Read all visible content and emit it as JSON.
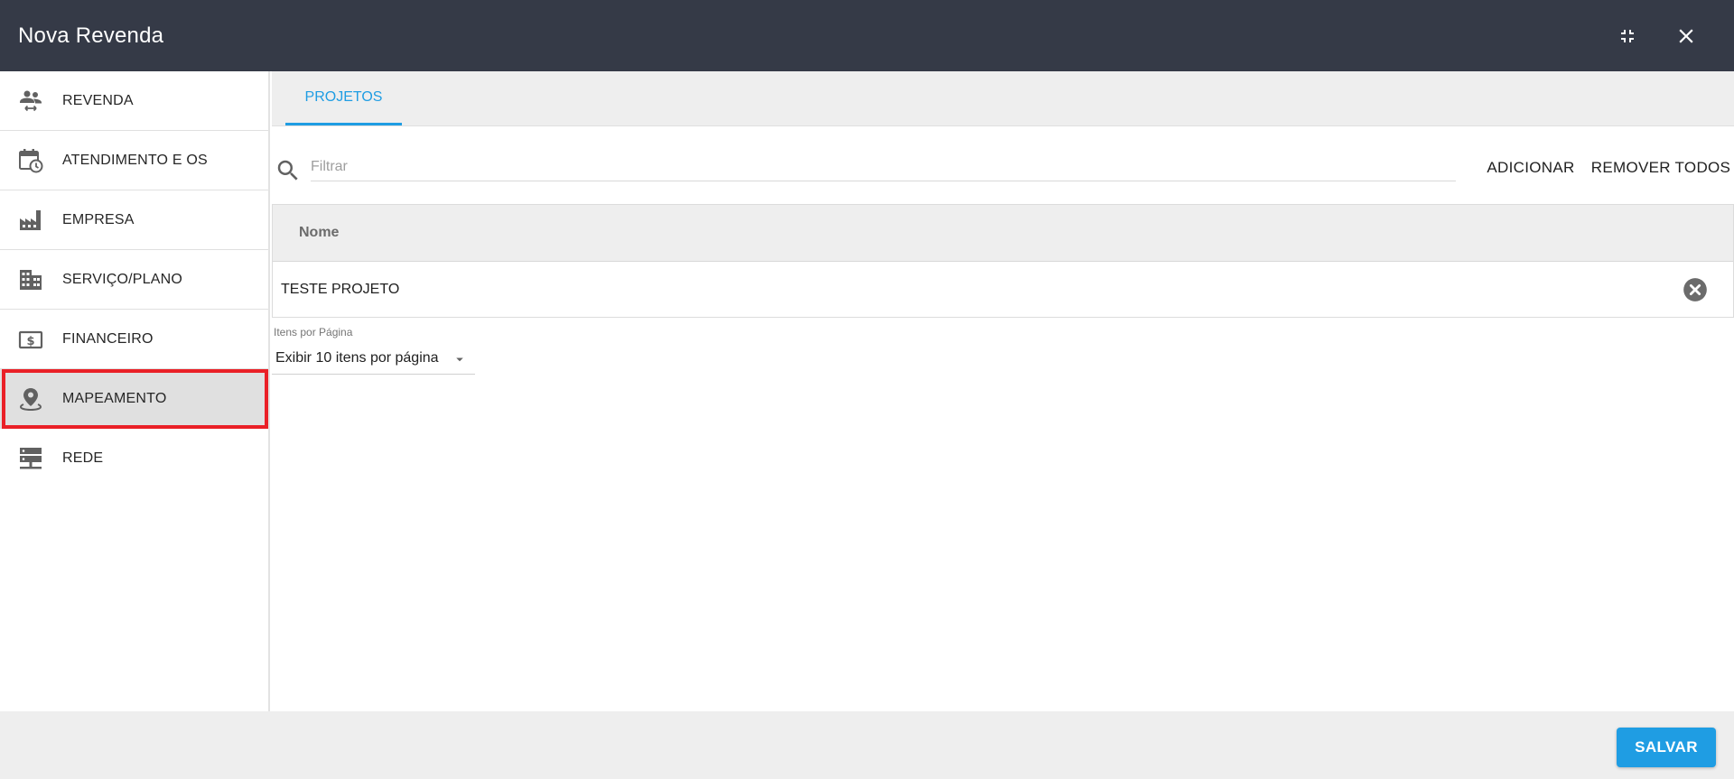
{
  "window": {
    "title": "Nova Revenda",
    "minimize_icon": "fullscreen-exit-icon",
    "close_icon": "close-icon"
  },
  "sidebar": {
    "items": [
      {
        "label": "REVENDA",
        "icon": "people-transfer-icon",
        "selected": false
      },
      {
        "label": "ATENDIMENTO E OS",
        "icon": "calendar-clock-icon",
        "selected": false
      },
      {
        "label": "EMPRESA",
        "icon": "factory-icon",
        "selected": false
      },
      {
        "label": "SERVIÇO/PLANO",
        "icon": "building-icon",
        "selected": false
      },
      {
        "label": "FINANCEIRO",
        "icon": "money-icon",
        "selected": false
      },
      {
        "label": "MAPEAMENTO",
        "icon": "map-pin-icon",
        "selected": true
      },
      {
        "label": "REDE",
        "icon": "server-network-icon",
        "selected": false
      }
    ]
  },
  "tabs": [
    {
      "label": "PROJETOS",
      "active": true
    }
  ],
  "toolbar": {
    "filter_placeholder": "Filtrar",
    "filter_value": "",
    "add_label": "ADICIONAR",
    "remove_all_label": "REMOVER TODOS"
  },
  "table": {
    "columns": [
      "Nome"
    ],
    "rows": [
      {
        "name": "TESTE PROJETO"
      }
    ]
  },
  "pagination": {
    "label": "Itens por Página",
    "selected": "Exibir 10 itens por página"
  },
  "footer": {
    "save_label": "SALVAR"
  },
  "colors": {
    "header_bg": "#353a47",
    "accent": "#1f9de3",
    "highlight_border": "#ea2027"
  }
}
